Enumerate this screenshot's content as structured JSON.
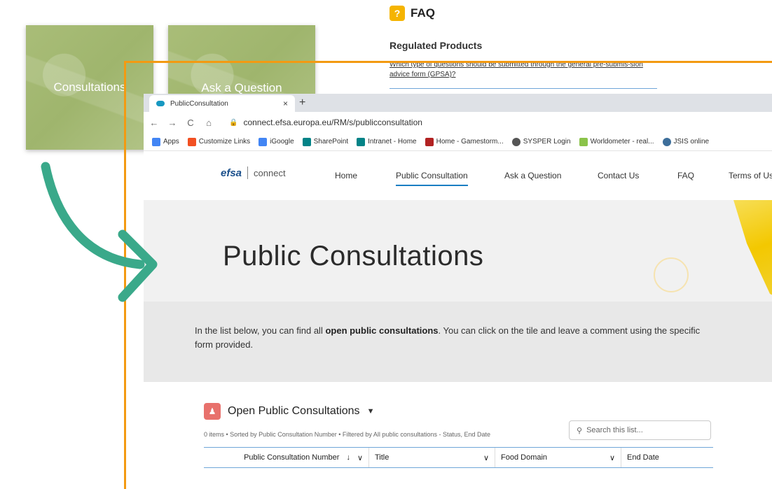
{
  "background": {
    "tiles": [
      {
        "label": "Consultations"
      },
      {
        "label": "Ask a Question"
      }
    ],
    "faq": {
      "title": "FAQ",
      "section": "Regulated Products",
      "question": "Which type of questions should be submitted through the general pre-submis-sion advice form (GPSA)?"
    }
  },
  "browser": {
    "tab": {
      "title": "PublicConsultation",
      "close": "×"
    },
    "new_tab": "+",
    "url": "connect.efsa.europa.eu/RM/s/publicconsultation",
    "bookmarks": [
      {
        "label": "Apps",
        "icon": "apps-grid-icon",
        "color": "#4285f4"
      },
      {
        "label": "Customize Links",
        "icon": "windows-icon",
        "color": "#f25022"
      },
      {
        "label": "iGoogle",
        "icon": "google-icon",
        "color": "#4285f4"
      },
      {
        "label": "SharePoint",
        "icon": "sharepoint-icon",
        "color": "#038387"
      },
      {
        "label": "Intranet - Home",
        "icon": "sharepoint-icon",
        "color": "#038387"
      },
      {
        "label": "Home - Gamestorm...",
        "icon": "gamestorm-icon",
        "color": "#b22222"
      },
      {
        "label": "SYSPER Login",
        "icon": "globe-icon",
        "color": "#555555"
      },
      {
        "label": "Worldometer - real...",
        "icon": "worldometer-icon",
        "color": "#8bc34a"
      },
      {
        "label": "JSIS online",
        "icon": "globe-icon",
        "color": "#3d6e9a"
      }
    ]
  },
  "site": {
    "logo": {
      "brand": "efsa",
      "product": "connect"
    },
    "nav": [
      {
        "label": "Home"
      },
      {
        "label": "Public Consultation"
      },
      {
        "label": "Ask a Question"
      },
      {
        "label": "Contact Us"
      },
      {
        "label": "FAQ"
      },
      {
        "label": "Terms of Us"
      }
    ],
    "hero_title": "Public Consultations",
    "intro": {
      "pre": "In the list below, you can find all ",
      "bold": "open public consultations",
      "post": ". You can click on the tile and leave a comment using the specific form provided."
    },
    "list": {
      "title": "Open Public Consultations",
      "meta": "0 items • Sorted by Public Consultation Number • Filtered by All public consultations - Status, End Date",
      "search_placeholder": "Search this list...",
      "columns": [
        {
          "label": "Public Consultation Number",
          "sort": "↓",
          "menu": "∨"
        },
        {
          "label": "Title",
          "menu": "∨"
        },
        {
          "label": "Food Domain",
          "menu": "∨"
        },
        {
          "label": "End Date"
        }
      ]
    }
  },
  "colors": {
    "accent_orange": "#f39a12",
    "arrow_teal": "#3aa98a",
    "link_blue": "#1a7ec3"
  }
}
